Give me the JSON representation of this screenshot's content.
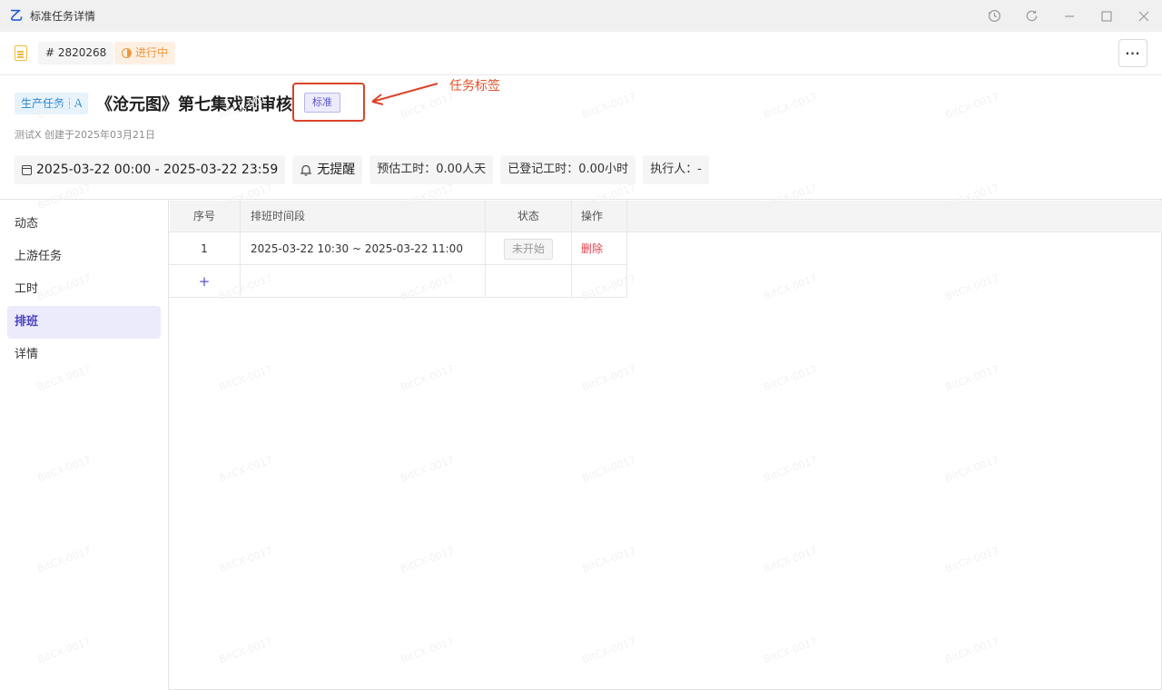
{
  "window": {
    "title": "标准任务详情",
    "logo_glyph": "乙",
    "controls": [
      "history-icon",
      "refresh-icon",
      "minimize-icon",
      "maximize-icon",
      "close-icon"
    ]
  },
  "header": {
    "task_id": "# 2820268",
    "status": "进行中",
    "more": "···"
  },
  "task": {
    "type_label": "生产任务",
    "type_grade": "A",
    "title": "《沧元图》第七集戏剧审核",
    "tag": "标准",
    "creator_line": "测试X 创建于2025年03月21日"
  },
  "annotation": {
    "label": "任务标签"
  },
  "info": {
    "date_range": "2025-03-22 00:00 - 2025-03-22 23:59",
    "reminder": "无提醒",
    "estimated": "预估工时：0.00人天",
    "logged": "已登记工时：0.00小时",
    "assignee": "执行人：-"
  },
  "sidebar": {
    "items": [
      {
        "label": "动态"
      },
      {
        "label": "上游任务"
      },
      {
        "label": "工时"
      },
      {
        "label": "排班"
      },
      {
        "label": "详情"
      }
    ],
    "active": "排班"
  },
  "table": {
    "headers": {
      "seq": "序号",
      "time": "排班时间段",
      "status": "状态",
      "op": "操作"
    },
    "rows": [
      {
        "seq": "1",
        "time": "2025-03-22 10:30 ~ 2025-03-22 11:00",
        "status": "未开始",
        "op": "删除"
      }
    ],
    "add": "+"
  },
  "watermark": "BitCX-0017",
  "colors": {
    "accent": "#5a53c9",
    "status_orange": "#f0953a",
    "danger": "#e0424f",
    "annotation": "#d9442a"
  }
}
